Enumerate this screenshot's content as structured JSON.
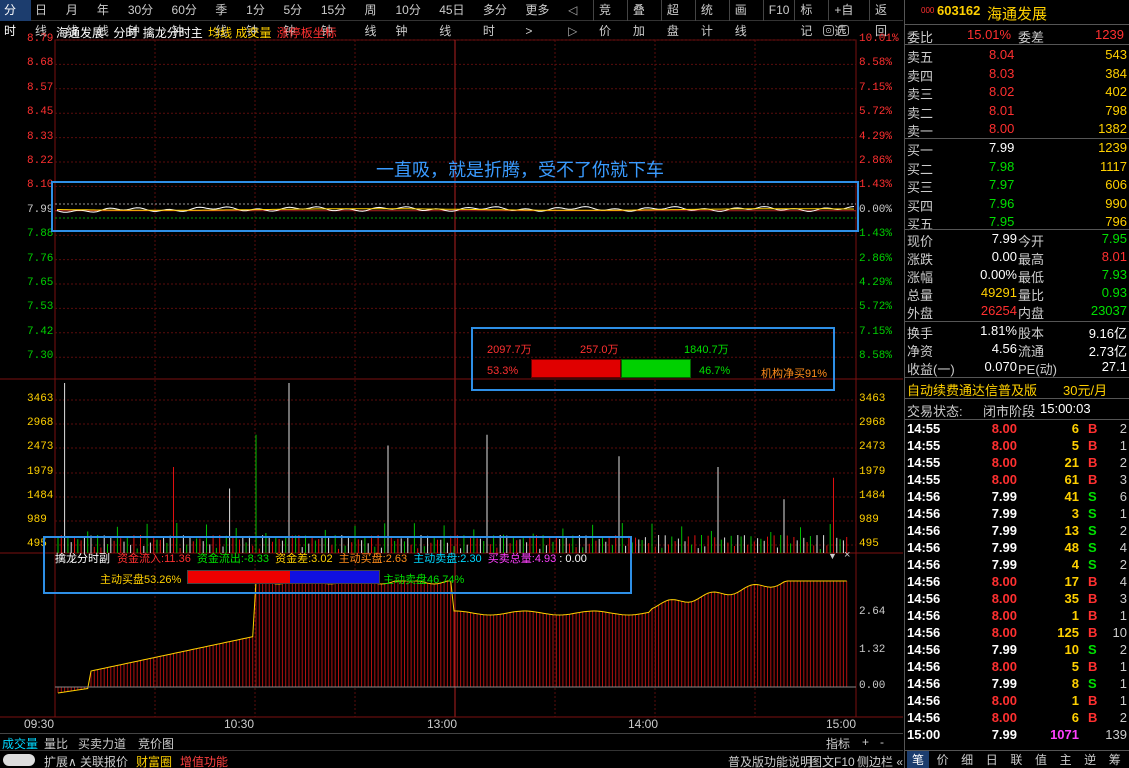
{
  "topbar": {
    "tabs": [
      "分时",
      "日线",
      "月线",
      "年线",
      "30分钟",
      "60分钟",
      "季线",
      "1分钟",
      "5分钟",
      "15分钟",
      "周线",
      "10分钟",
      "45日线",
      "多分时",
      "更多 >"
    ],
    "arrows": "◁ ▷",
    "right": [
      "竞价",
      "叠加",
      "超盘",
      "统计",
      "画线",
      "F10",
      "标记",
      "+自选",
      "返回"
    ]
  },
  "chart": {
    "stock_name": "海通发展",
    "mode": "分时",
    "indicator": "擒龙分时主",
    "avg_label": "均线",
    "vol_label": "成交量",
    "limit_label": "涨停板坐标",
    "price_labels": [
      "8.79",
      "8.68",
      "8.57",
      "8.45",
      "8.33",
      "8.22",
      "8.10",
      "7.99",
      "7.88",
      "7.76",
      "7.65",
      "7.53",
      "7.42",
      "7.30"
    ],
    "pct_labels": [
      "10.01%",
      "8.58%",
      "7.15%",
      "5.72%",
      "4.29%",
      "2.86%",
      "1.43%",
      "0.00%",
      "1.43%",
      "2.86%",
      "4.29%",
      "5.72%",
      "7.15%",
      "8.58%"
    ],
    "vol_labels": [
      "3463",
      "2968",
      "2473",
      "1979",
      "1484",
      "989",
      "495"
    ],
    "sub_labels": [
      "2.64",
      "1.32",
      "0.00"
    ],
    "time_labels": [
      "09:30",
      "10:30",
      "13:00",
      "14:00",
      "15:00"
    ],
    "annotation": "一直吸，就是折腾，受不了你就下车",
    "fund_box": {
      "a": "2097.7万",
      "b": "257.0万",
      "c": "1840.7万",
      "pct_left": "53.3%",
      "pct_right": "46.7%",
      "net": "机构净买91%"
    },
    "sub_box": {
      "title": "擒龙分时副",
      "in_label": "资金流入:",
      "in_val": "11.36",
      "out_label": "资金流出:",
      "out_val": "-8.33",
      "diff_label": "资金差:",
      "diff_val": "3.02",
      "buy_label": "主动买盘:",
      "buy_val": "2.63",
      "sell_label": "主动卖盘:",
      "sell_val": "2.30",
      "total_label": "买卖总量:",
      "total_val": "4.93",
      "tail": ": 0.00",
      "bar_left": "主动买盘53.26%",
      "bar_right": "主动卖盘46.74%",
      "buy_fraction": 0.5326
    }
  },
  "bottom": {
    "tabs1": [
      "成交量",
      "量比",
      "买卖力道",
      "竞价图"
    ],
    "right1": [
      "指标",
      "+",
      "-"
    ],
    "tabs2": [
      "扩展∧",
      "关联报价",
      "财富圈",
      "增值功能"
    ],
    "right2": [
      "普及版功能说明",
      "图文F10",
      "侧边栏 «"
    ]
  },
  "panel": {
    "code": "603162",
    "name": "海通发展",
    "code_prefix": "000",
    "webi_label": "委比",
    "webi": "15.01%",
    "weicha_label": "委差",
    "weicha": "1239",
    "asks": [
      {
        "l": "卖五",
        "p": "8.04",
        "v": "543"
      },
      {
        "l": "卖四",
        "p": "8.03",
        "v": "384"
      },
      {
        "l": "卖三",
        "p": "8.02",
        "v": "402"
      },
      {
        "l": "卖二",
        "p": "8.01",
        "v": "798"
      },
      {
        "l": "卖一",
        "p": "8.00",
        "v": "1382"
      }
    ],
    "bids": [
      {
        "l": "买一",
        "p": "7.99",
        "v": "1239"
      },
      {
        "l": "买二",
        "p": "7.98",
        "v": "1117"
      },
      {
        "l": "买三",
        "p": "7.97",
        "v": "606"
      },
      {
        "l": "买四",
        "p": "7.96",
        "v": "990"
      },
      {
        "l": "买五",
        "p": "7.95",
        "v": "796"
      }
    ],
    "stats": [
      {
        "l1": "现价",
        "v1": "7.99",
        "l2": "今开",
        "v2": "7.95"
      },
      {
        "l1": "涨跌",
        "v1": "0.00",
        "l2": "最高",
        "v2": "8.01"
      },
      {
        "l1": "涨幅",
        "v1": "0.00%",
        "l2": "最低",
        "v2": "7.93"
      },
      {
        "l1": "总量",
        "v1": "49291",
        "l2": "量比",
        "v2": "0.93"
      },
      {
        "l1": "外盘",
        "v1": "26254",
        "l2": "内盘",
        "v2": "23037"
      }
    ],
    "stats2": [
      {
        "l1": "换手",
        "v1": "1.81%",
        "l2": "股本",
        "v2": "9.16亿"
      },
      {
        "l1": "净资",
        "v1": "4.56",
        "l2": "流通",
        "v2": "2.73亿"
      },
      {
        "l1": "收益(一)",
        "v1": "0.070",
        "l2": "PE(动)",
        "v2": "27.1"
      }
    ],
    "promo": "自动续费通达信普及版",
    "price_tag": "30元/月",
    "status_label": "交易状态:",
    "status": "闭市阶段",
    "status_time": "15:00:03",
    "ticks": [
      [
        "14:55",
        "8.00",
        "6",
        "B",
        "2"
      ],
      [
        "14:55",
        "8.00",
        "5",
        "B",
        "1"
      ],
      [
        "14:55",
        "8.00",
        "21",
        "B",
        "2"
      ],
      [
        "14:55",
        "8.00",
        "61",
        "B",
        "3"
      ],
      [
        "14:56",
        "7.99",
        "41",
        "S",
        "6"
      ],
      [
        "14:56",
        "7.99",
        "3",
        "S",
        "1"
      ],
      [
        "14:56",
        "7.99",
        "13",
        "S",
        "2"
      ],
      [
        "14:56",
        "7.99",
        "48",
        "S",
        "4"
      ],
      [
        "14:56",
        "7.99",
        "4",
        "S",
        "2"
      ],
      [
        "14:56",
        "8.00",
        "17",
        "B",
        "4"
      ],
      [
        "14:56",
        "8.00",
        "35",
        "B",
        "3"
      ],
      [
        "14:56",
        "8.00",
        "1",
        "B",
        "1"
      ],
      [
        "14:56",
        "8.00",
        "125",
        "B",
        "10"
      ],
      [
        "14:56",
        "7.99",
        "10",
        "S",
        "2"
      ],
      [
        "14:56",
        "8.00",
        "5",
        "B",
        "1"
      ],
      [
        "14:56",
        "7.99",
        "8",
        "S",
        "1"
      ],
      [
        "14:56",
        "8.00",
        "1",
        "B",
        "1"
      ],
      [
        "14:56",
        "8.00",
        "6",
        "B",
        "2"
      ],
      [
        "15:00",
        "7.99",
        "1071",
        "",
        "139"
      ]
    ],
    "bottom_tabs": [
      "笔",
      "价",
      "细",
      "日",
      "联",
      "值",
      "主",
      "逆",
      "筹"
    ]
  }
}
